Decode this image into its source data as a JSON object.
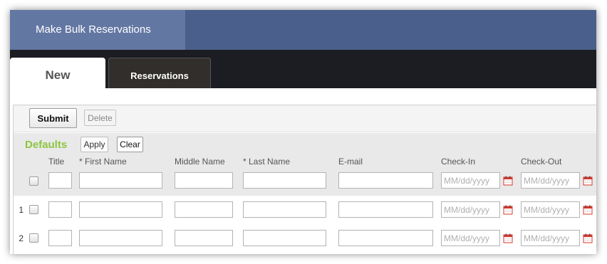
{
  "header": {
    "title": "Make Bulk Reservations"
  },
  "tabs": [
    {
      "label": "New",
      "active": true
    },
    {
      "label": "Reservations",
      "active": false
    }
  ],
  "toolbar": {
    "submit_label": "Submit",
    "delete_label": "Delete"
  },
  "defaults": {
    "label": "Defaults",
    "apply_label": "Apply",
    "clear_label": "Clear"
  },
  "columns": {
    "title": "Title",
    "first_name": "* First Name",
    "middle_name": "Middle Name",
    "last_name": "* Last Name",
    "email": "E-mail",
    "check_in": "Check-In",
    "check_out": "Check-Out"
  },
  "date_placeholder": "MM/dd/yyyy",
  "rows": [
    {
      "number": "1"
    },
    {
      "number": "2"
    }
  ],
  "colors": {
    "header_bg": "#4a5f8b",
    "header_title_bg": "#6377a3",
    "tabbar_bg": "#1c1d22",
    "defaults_label": "#8cc63f",
    "calendar_icon": "#d9372b"
  }
}
